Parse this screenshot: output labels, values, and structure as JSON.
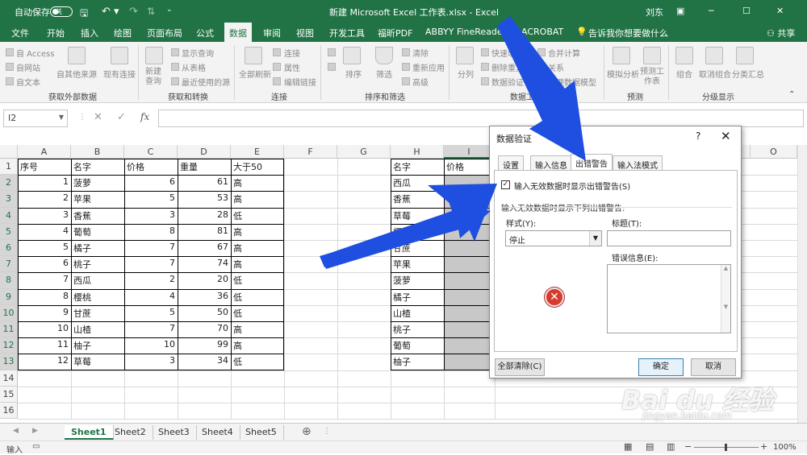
{
  "titlebar": {
    "autosave_label": "自动保存",
    "toggle_state": "关",
    "title": "新建 Microsoft Excel 工作表.xlsx - Excel",
    "user": "刘东",
    "accent_color": "#217346"
  },
  "ribbon_tabs": [
    "文件",
    "开始",
    "插入",
    "绘图",
    "页面布局",
    "公式",
    "数据",
    "审阅",
    "视图",
    "开发工具",
    "福昕PDF",
    "ABBYY FineReader 12",
    "ACROBAT",
    "告诉我你想要做什么"
  ],
  "active_tab": "数据",
  "share_label": "共享",
  "ribbon": {
    "get_external": {
      "items": [
        "自 Access",
        "自网站",
        "自文本",
        "自其他来源",
        "现有连接"
      ],
      "group": "获取外部数据"
    },
    "get_transform": {
      "items": [
        "新建查询",
        "显示查询",
        "从表格",
        "最近使用的源"
      ],
      "group": "获取和转换"
    },
    "connections": {
      "items": [
        "全部刷新",
        "连接",
        "属性",
        "编辑链接"
      ],
      "group": "连接"
    },
    "sort_filter": {
      "items": [
        "排序",
        "筛选",
        "清除",
        "重新应用",
        "高级"
      ],
      "group": "排序和筛选"
    },
    "data_tools": {
      "items": [
        "分列",
        "快速填充",
        "删除重复项",
        "数据验证",
        "合并计算",
        "关系",
        "管理数据模型"
      ],
      "group": "数据工具"
    },
    "forecast": {
      "items": [
        "模拟分析",
        "预测工作表"
      ],
      "group": "预测"
    },
    "outline": {
      "items": [
        "组合",
        "取消组合",
        "分类汇总"
      ],
      "group": "分级显示"
    }
  },
  "formula_bar": {
    "name_box": "I2",
    "fx": "fx",
    "value": ""
  },
  "columns": [
    "A",
    "B",
    "C",
    "D",
    "E",
    "F",
    "G",
    "H",
    "I",
    "O"
  ],
  "rows": [
    "1",
    "2",
    "3",
    "4",
    "5",
    "6",
    "7",
    "8",
    "9",
    "10",
    "11",
    "12",
    "13",
    "14",
    "15",
    "16"
  ],
  "table": {
    "headers": [
      "序号",
      "名字",
      "价格",
      "重量",
      "大于50"
    ],
    "rows": [
      [
        "1",
        "菠萝",
        "6",
        "61",
        "高"
      ],
      [
        "2",
        "苹果",
        "5",
        "53",
        "高"
      ],
      [
        "3",
        "香蕉",
        "3",
        "28",
        "低"
      ],
      [
        "4",
        "葡萄",
        "8",
        "81",
        "高"
      ],
      [
        "5",
        "橘子",
        "7",
        "67",
        "高"
      ],
      [
        "6",
        "桃子",
        "7",
        "74",
        "高"
      ],
      [
        "7",
        "西瓜",
        "2",
        "20",
        "低"
      ],
      [
        "8",
        "樱桃",
        "4",
        "36",
        "低"
      ],
      [
        "9",
        "甘蔗",
        "5",
        "50",
        "低"
      ],
      [
        "10",
        "山楂",
        "7",
        "70",
        "高"
      ],
      [
        "11",
        "柚子",
        "10",
        "99",
        "高"
      ],
      [
        "12",
        "草莓",
        "3",
        "34",
        "低"
      ]
    ]
  },
  "lookup": {
    "headers": [
      "名字",
      "价格"
    ],
    "names": [
      "西瓜",
      "香蕉",
      "草莓",
      "樱桃",
      "甘蔗",
      "苹果",
      "菠萝",
      "橘子",
      "山楂",
      "桃子",
      "葡萄",
      "柚子"
    ]
  },
  "sheet_tabs": [
    "Sheet1",
    "Sheet2",
    "Sheet3",
    "Sheet4",
    "Sheet5"
  ],
  "active_sheet": "Sheet1",
  "status": {
    "mode": "输入",
    "zoom": "100%"
  },
  "dialog": {
    "title": "数据验证",
    "help": "?",
    "close": "✕",
    "tabs": [
      "设置",
      "输入信息",
      "出错警告",
      "输入法模式"
    ],
    "active_tab": "出错警告",
    "check_label": "输入无效数据时显示出错警告(S)",
    "checked": true,
    "section_label": "输入无效数据时显示下列出错警告:",
    "style_label": "样式(Y):",
    "style_value": "停止",
    "title_label": "标题(T):",
    "title_value": "",
    "message_label": "错误信息(E):",
    "message_value": "",
    "clear_all": "全部清除(C)",
    "ok": "确定",
    "cancel": "取消"
  },
  "watermark": {
    "main": "Bai du 经验",
    "sub": "jingyan.baidu.com"
  }
}
